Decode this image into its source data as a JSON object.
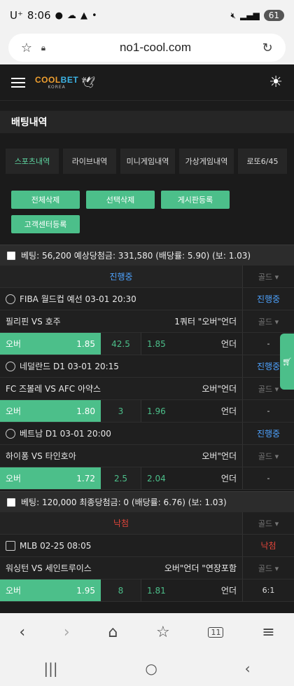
{
  "status_bar": {
    "carrier": "U⁺",
    "time": "8:06",
    "battery": "61"
  },
  "browser": {
    "url": "no1-cool.com"
  },
  "site": {
    "brand_c1": "COOL",
    "brand_c2": "BET",
    "brand_sub": "KOREA"
  },
  "page": {
    "title": "배팅내역"
  },
  "tabs": [
    "스포츠내역",
    "라이브내역",
    "미니게임내역",
    "가상게임내역",
    "로또6/45"
  ],
  "actions": {
    "delete_all": "전체삭제",
    "delete_selected": "선택삭제",
    "post_board": "게시판등록",
    "support": "고객센터등록"
  },
  "bets": [
    {
      "summary": "베팅: 56,200 예상당첨금: 331,580 (배당률: 5.90) (보: 1.03)",
      "status": "진행중",
      "side_label": "골드 ▾",
      "games": [
        {
          "league": "FIBA 월드컵 예선  03-01 20:30",
          "result": "진행중",
          "teams": "필리핀 VS 호주",
          "market": "1쿼터 \"오버\"언더",
          "side": "골드 ▾",
          "over_label": "오버",
          "over_odds": "1.85",
          "line": "42.5",
          "under_odds": "1.85",
          "under_label": "언더",
          "pick": "-"
        },
        {
          "league": "네덜란드 D1  03-01 20:15",
          "result": "진행중",
          "teams": "FC 즈볼레 VS AFC 아약스",
          "market": "오버\"언더",
          "side": "골드 ▾",
          "over_label": "오버",
          "over_odds": "1.80",
          "line": "3",
          "under_odds": "1.96",
          "under_label": "언더",
          "pick": "-"
        },
        {
          "league": "베트남 D1  03-01 20:00",
          "result": "진행중",
          "teams": "하이퐁 VS 타인호아",
          "market": "오버\"언더",
          "side": "골드 ▾",
          "over_label": "오버",
          "over_odds": "1.72",
          "line": "2.5",
          "under_odds": "2.04",
          "under_label": "언더",
          "pick": "-"
        }
      ]
    },
    {
      "summary": "베팅: 120,000 최종당첨금: 0 (배당률: 6.76) (보: 1.03)",
      "status": "낙첨",
      "side_label": "골드 ▾",
      "games": [
        {
          "league": "MLB  02-25 08:05",
          "result": "낙첨",
          "teams": "워싱턴 VS 세인트루이스",
          "market": "오버\"언더 \"연장포함",
          "side": "골드 ▾",
          "over_label": "오버",
          "over_odds": "1.95",
          "line": "8",
          "under_odds": "1.81",
          "under_label": "언더",
          "pick": "6:1"
        }
      ]
    }
  ],
  "nav": {
    "tab_count": "11"
  }
}
